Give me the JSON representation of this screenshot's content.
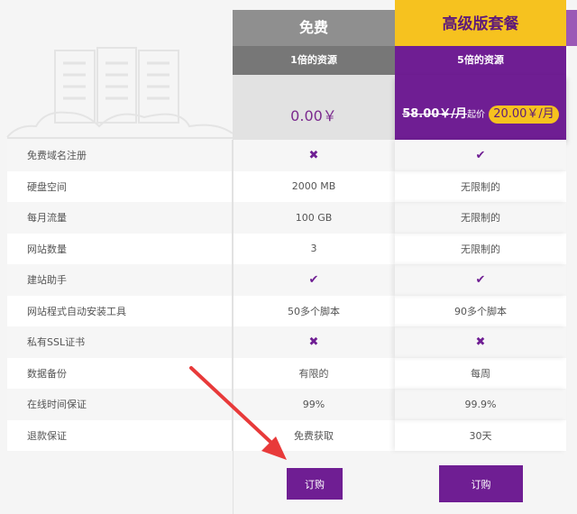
{
  "plans": [
    {
      "title": "免费",
      "subtitle": "1倍的资源",
      "price": "0.00￥",
      "order_label": "订购"
    },
    {
      "title": "高级版套餐",
      "subtitle": "5倍的资源",
      "old_price": "58.00￥/月",
      "from_label": "起价",
      "price": "20.00￥/月",
      "order_label": "订购"
    }
  ],
  "features": [
    {
      "label": "免费域名注册",
      "free": "✖",
      "pro": "✔"
    },
    {
      "label": "硬盘空间",
      "free": "2000 MB",
      "pro": "无限制的"
    },
    {
      "label": "每月流量",
      "free": "100 GB",
      "pro": "无限制的"
    },
    {
      "label": "网站数量",
      "free": "3",
      "pro": "无限制的"
    },
    {
      "label": "建站助手",
      "free": "✔",
      "pro": "✔"
    },
    {
      "label": "网站程式自动安装工具",
      "free": "50多个脚本",
      "pro": "90多个脚本"
    },
    {
      "label": "私有SSL证书",
      "free": "✖",
      "pro": "✖"
    },
    {
      "label": "数据备份",
      "free": "有限的",
      "pro": "每周"
    },
    {
      "label": "在线时间保证",
      "free": "99%",
      "pro": "99.9%"
    },
    {
      "label": "退款保证",
      "free": "免费获取",
      "pro": "30天"
    }
  ],
  "colors": {
    "accent": "#6f1e93",
    "highlight": "#f6c21f",
    "arrow": "#e83a3a"
  }
}
